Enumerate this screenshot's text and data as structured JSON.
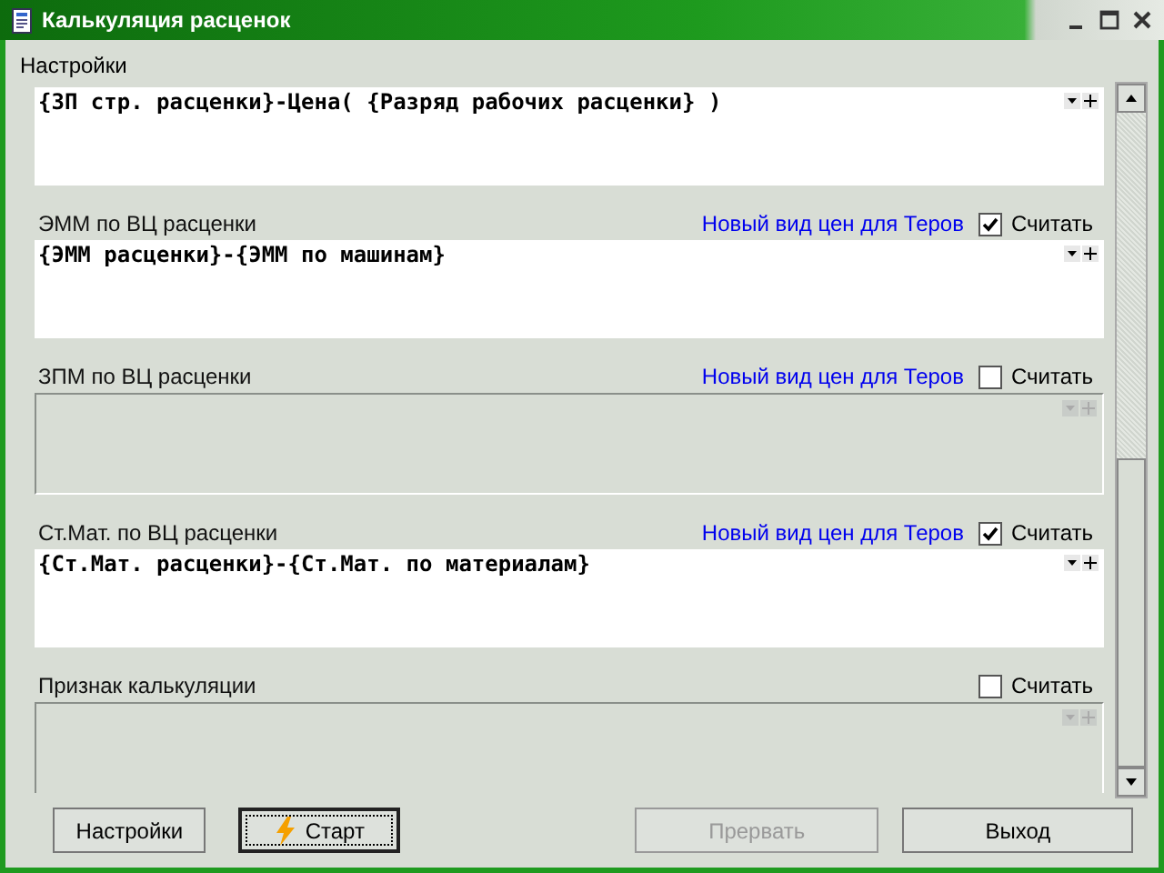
{
  "window": {
    "title": "Калькуляция расценок"
  },
  "settings_label": "Настройки",
  "sections": [
    {
      "formula": "{ЗП стр. расценки}-Цена( {Разряд рабочих расценки} )",
      "disabled": false
    },
    {
      "label": "ЭММ по ВЦ расценки",
      "link": "Новый вид цен для Теров",
      "checkbox": {
        "label": "Считать",
        "checked": true
      },
      "formula": "{ЭММ расценки}-{ЭММ по машинам}",
      "disabled": false
    },
    {
      "label": "ЗПМ по ВЦ расценки",
      "link": "Новый вид цен для Теров",
      "checkbox": {
        "label": "Считать",
        "checked": false
      },
      "disabled": true
    },
    {
      "label": "Ст.Мат. по ВЦ расценки",
      "link": "Новый вид цен для Теров",
      "checkbox": {
        "label": "Считать",
        "checked": true
      },
      "formula": "{Ст.Мат. расценки}-{Ст.Мат. по материалам}",
      "disabled": false
    },
    {
      "label": "Признак калькуляции",
      "checkbox": {
        "label": "Считать",
        "checked": false
      },
      "disabled": true
    }
  ],
  "buttons": [
    {
      "label": "Настройки",
      "kind": "text",
      "disabled": false,
      "focused": false
    },
    {
      "label": "Старт",
      "kind": "start",
      "disabled": false,
      "focused": true
    },
    {
      "label": "Прервать",
      "kind": "text",
      "disabled": true,
      "focused": false
    },
    {
      "label": "Выход",
      "kind": "text",
      "disabled": false,
      "focused": false
    }
  ]
}
